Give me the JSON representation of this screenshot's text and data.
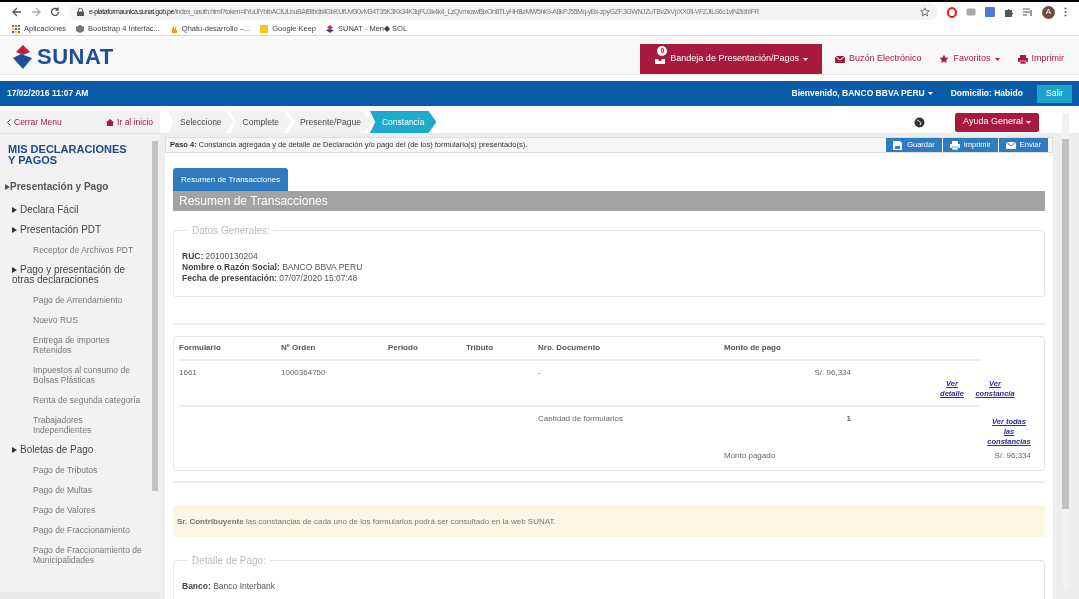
{
  "browser": {
    "url_host": "e-plataformaunica.sunat.gob.pe",
    "url_path": "/index_oauth.html?token=IlYuUlYbIbACIULbuBAfBIbdbIlGbKUfUvf30vM34T35K3Kk34K3qFU3k4k4_LzQvmxawBixOn8TLyHHBzMW5hk9-A8kPJ55Mq-yBx-zpyGZF.3GWNJZuTBvZkVpXX0It-VFZJILS6c1viN2idbIFR",
    "avatar_letter": "A",
    "bookmarks": [
      {
        "label": "Aplicaciones",
        "kind": "apps"
      },
      {
        "label": "Bootstrap 4 Interfac...",
        "kind": "cube"
      },
      {
        "label": "Qhatu-desarrollo –...",
        "kind": "hand"
      },
      {
        "label": "Google Keep",
        "kind": "note"
      },
      {
        "label": "SUNAT - Men◆ SOL",
        "kind": "sunat"
      }
    ]
  },
  "header": {
    "logo": "SUNAT",
    "nav": [
      {
        "label": "Bandeja de Presentación/Pagos",
        "kind": "inbox",
        "badge": "0",
        "dropdown": true,
        "primary": true
      },
      {
        "label": "Buzón Electrónico",
        "kind": "mail",
        "dropdown": false,
        "primary": false
      },
      {
        "label": "Favoritos",
        "kind": "star",
        "dropdown": true,
        "primary": false
      },
      {
        "label": "Imprimir",
        "kind": "print",
        "dropdown": false,
        "primary": false
      }
    ]
  },
  "user_bar": {
    "date": "17/02/2016 11:07 AM",
    "user": "Bienvenido, BANCO BBVA PERU",
    "domicilio": "Domicilio: Habido",
    "logout": "Salir"
  },
  "sidebar": {
    "close": "Cerrar Menu",
    "home": "Ir al inicio",
    "title": "MIS DECLARACIONES Y PAGOS",
    "items": [
      {
        "label": "Presentación y Pago",
        "kind": "group",
        "children": [
          {
            "label": "Declara Fácil",
            "kind": "group"
          },
          {
            "label": "Presentación PDT",
            "kind": "group",
            "children": [
              {
                "label": "Receptor de Archivos PDT",
                "kind": "link"
              }
            ]
          },
          {
            "label": "Pago y presentación de otras declaraciones",
            "kind": "group",
            "children": [
              {
                "label": "Pago de Arrendamiento",
                "kind": "link"
              },
              {
                "label": "Nuevo RUS",
                "kind": "link"
              },
              {
                "label": "Entrega de importes Retenidos",
                "kind": "link"
              },
              {
                "label": "Impuestos al consumo de Bolsas Plásticas",
                "kind": "link"
              },
              {
                "label": "Renta de segunda categoría",
                "kind": "link"
              },
              {
                "label": "Trabajadores Independientes",
                "kind": "link"
              }
            ]
          },
          {
            "label": "Boletas de Pago",
            "kind": "group",
            "children": [
              {
                "label": "Pago de Tributos",
                "kind": "link"
              },
              {
                "label": "Pago de Multas",
                "kind": "link"
              },
              {
                "label": "Pago de Valores",
                "kind": "link"
              },
              {
                "label": "Pago de Fraccionamiento",
                "kind": "link"
              },
              {
                "label": "Pago de Fraccionamiento de Municipalidades",
                "kind": "link"
              }
            ]
          }
        ]
      }
    ]
  },
  "steps": [
    {
      "label": "Seleccione",
      "selected": false
    },
    {
      "label": "Complete",
      "selected": false
    },
    {
      "label": "Presente/Pague",
      "selected": false
    },
    {
      "label": "Constancia",
      "selected": true
    }
  ],
  "help": "Ayuda General",
  "step_text": "**Paso 4:** Constancia agregada y de detalle de Declaración y/o pago del (de los) formulario(s) presentado(s).",
  "actions": [
    {
      "label": "Guardar",
      "kind": "save"
    },
    {
      "label": "Imprimir",
      "kind": "print"
    },
    {
      "label": "Enviar",
      "kind": "mail"
    }
  ],
  "tab_button": "Resumen de Transacciones",
  "section_title": "Resumen de Transacciones",
  "general": {
    "legend": "Datos Generales:",
    "fields": [
      {
        "label": "RUC:",
        "value": "20100130204"
      },
      {
        "label": "Nombre o Razón Social:",
        "value": "BANCO BBVA PERU"
      },
      {
        "label": "Fecha de presentación:",
        "value": "07/07/2020 15:07:48"
      }
    ]
  },
  "table": {
    "columns": [
      "Formulario",
      "Nº Orden",
      "Periodo",
      "Tributo",
      "Nro. Documento",
      "Monto de pago"
    ],
    "rows": [
      {
        "cells": [
          "1661",
          "1000364750",
          null,
          null,
          "-",
          "S/. 96,334"
        ],
        "links": [
          "Ver detalle",
          "Ver constancia"
        ]
      }
    ],
    "summary": {
      "label": "Cantidad de formularios",
      "count": "1",
      "link": "Ver todas las constancias"
    },
    "total": {
      "label": "Monto pagado",
      "value": "S/. 96,334"
    }
  },
  "notice": "**Sr. Contribuyente** las constancias de cada uno de los formularios podrá ser consultado en la web SUNAT.",
  "payment": {
    "legend": "Detalle de Pago:",
    "fields": [
      {
        "label": "Banco:",
        "value": "Banco Interbank"
      }
    ]
  }
}
